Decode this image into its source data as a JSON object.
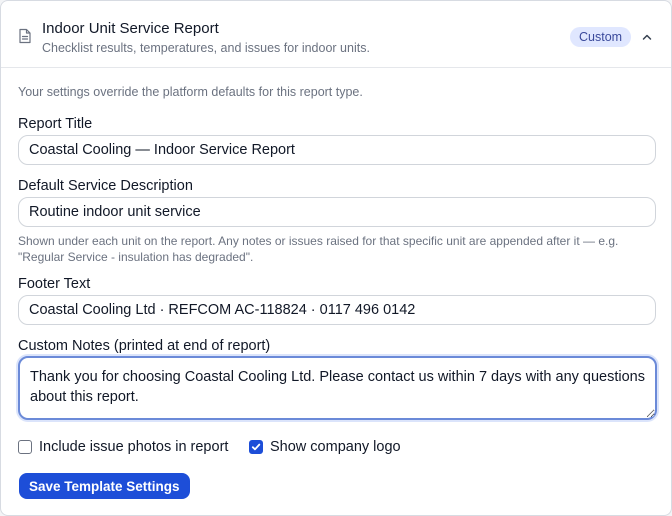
{
  "header": {
    "title": "Indoor Unit Service Report",
    "subtitle": "Checklist results, temperatures, and issues for indoor units.",
    "badge": "Custom",
    "icon": "document-icon",
    "collapse_icon": "chevron-up-icon"
  },
  "intro": "Your settings override the platform defaults for this report type.",
  "fields": {
    "report_title": {
      "label": "Report Title",
      "value": "Coastal Cooling — Indoor Service Report"
    },
    "default_description": {
      "label": "Default Service Description",
      "value": "Routine indoor unit service",
      "hint": "Shown under each unit on the report. Any notes or issues raised for that specific unit are appended after it — e.g. \"Regular Service - insulation has degraded\"."
    },
    "footer_text": {
      "label": "Footer Text",
      "value": "Coastal Cooling Ltd · REFCOM AC-118824 · 0117 496 0142"
    },
    "custom_notes": {
      "label": "Custom Notes (printed at end of report)",
      "value": "Thank you for choosing Coastal Cooling Ltd. Please contact us within 7 days with any questions about this report."
    }
  },
  "options": {
    "include_photos": {
      "label": "Include issue photos in report",
      "checked": false
    },
    "show_logo": {
      "label": "Show company logo",
      "checked": true
    }
  },
  "actions": {
    "save_label": "Save Template Settings"
  },
  "colors": {
    "accent": "#1d4ed8",
    "badge_bg": "#e0e7ff",
    "badge_text": "#3b4a9c",
    "focus_ring": "#6b8ad8"
  }
}
